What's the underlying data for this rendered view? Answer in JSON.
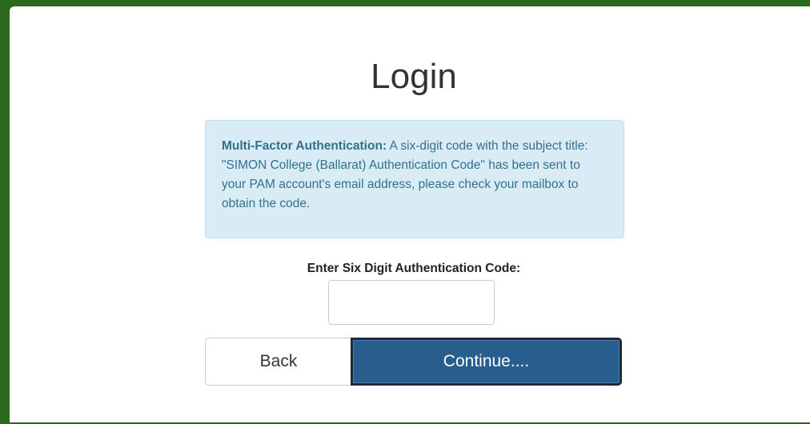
{
  "page": {
    "title": "Login"
  },
  "mfa_notice": {
    "heading": "Multi-Factor Authentication:",
    "message": " A six-digit code with the subject title: \"SIMON College (Ballarat) Authentication Code\" has been sent to your PAM account's email address, please check your mailbox to obtain the code."
  },
  "code_field": {
    "label": "Enter Six Digit Authentication Code:",
    "value": "",
    "placeholder": ""
  },
  "actions": {
    "back_label": "Back",
    "continue_label": "Continue...."
  },
  "colors": {
    "frame": "#2b6a1e",
    "alert_bg": "#d9ecf6",
    "alert_text": "#31708f",
    "primary_button": "#285e8e"
  }
}
